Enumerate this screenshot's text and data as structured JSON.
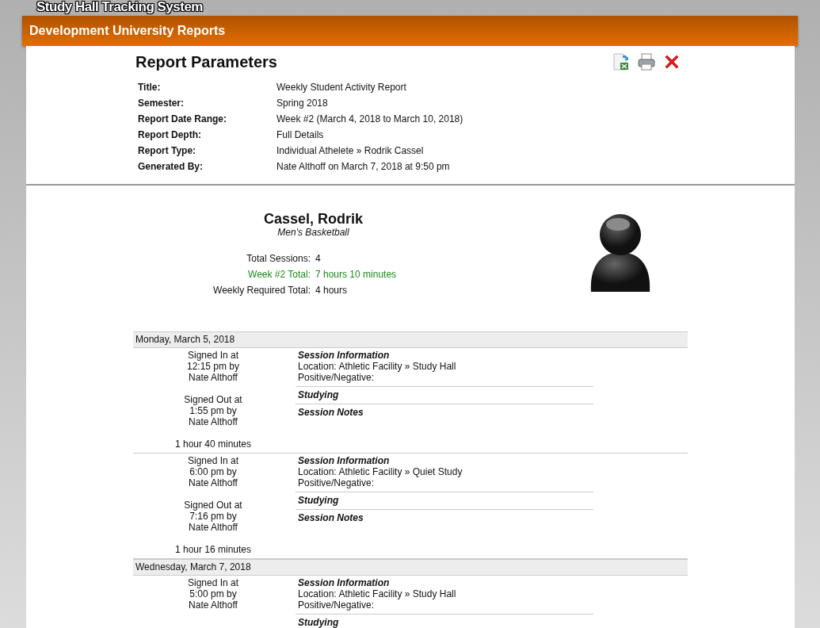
{
  "app_title": "Study Hall Tracking System",
  "header": {
    "title": "Development University Reports"
  },
  "parameters": {
    "heading": "Report Parameters",
    "rows": [
      {
        "label": "Title:",
        "value": "Weekly Student Activity Report"
      },
      {
        "label": "Semester:",
        "value": "Spring 2018"
      },
      {
        "label": "Report Date Range:",
        "value": "Week #2 (March 4, 2018 to March 10, 2018)"
      },
      {
        "label": "Report Depth:",
        "value": "Full Details"
      },
      {
        "label": "Report Type:",
        "value": "Individual Athelete » Rodrik Cassel"
      },
      {
        "label": "Generated By:",
        "value": "Nate Althoff on March 7, 2018 at 9:50 pm"
      }
    ]
  },
  "athlete": {
    "name": "Cassel, Rodrik",
    "sport": "Men's Basketball",
    "stats": [
      {
        "label": "Total Sessions:",
        "value": "4",
        "highlighted": false
      },
      {
        "label": "Week #2 Total:",
        "value": "7 hours 10 minutes",
        "highlighted": true
      },
      {
        "label": "Weekly Required Total:",
        "value": "4 hours",
        "highlighted": false
      }
    ]
  },
  "days": [
    {
      "date": "Monday, March 5, 2018",
      "sessions": [
        {
          "signed_in": "Signed In at\n12:15 pm by\nNate Althoff",
          "signed_out": "Signed Out at\n1:55 pm by\nNate Althoff",
          "duration": "1 hour 40 minutes",
          "info_title": "Session Information",
          "location": "Location: Athletic Facility » Study Hall",
          "positive_negative": "Positive/Negative:",
          "studying": "Studying",
          "notes": "Session Notes"
        },
        {
          "signed_in": "Signed In at\n6:00 pm by\nNate Althoff",
          "signed_out": "Signed Out at\n7:16 pm by\nNate Althoff",
          "duration": "1 hour 16 minutes",
          "info_title": "Session Information",
          "location": "Location: Athletic Facility » Quiet Study",
          "positive_negative": "Positive/Negative:",
          "studying": "Studying",
          "notes": "Session Notes"
        }
      ]
    },
    {
      "date": "Wednesday, March 7, 2018",
      "sessions": [
        {
          "signed_in": "Signed In at\n5:00 pm by\nNate Althoff",
          "info_title": "Session Information",
          "location": "Location: Athletic Facility » Study Hall",
          "positive_negative": "Positive/Negative:",
          "studying": "Studying"
        }
      ]
    }
  ]
}
